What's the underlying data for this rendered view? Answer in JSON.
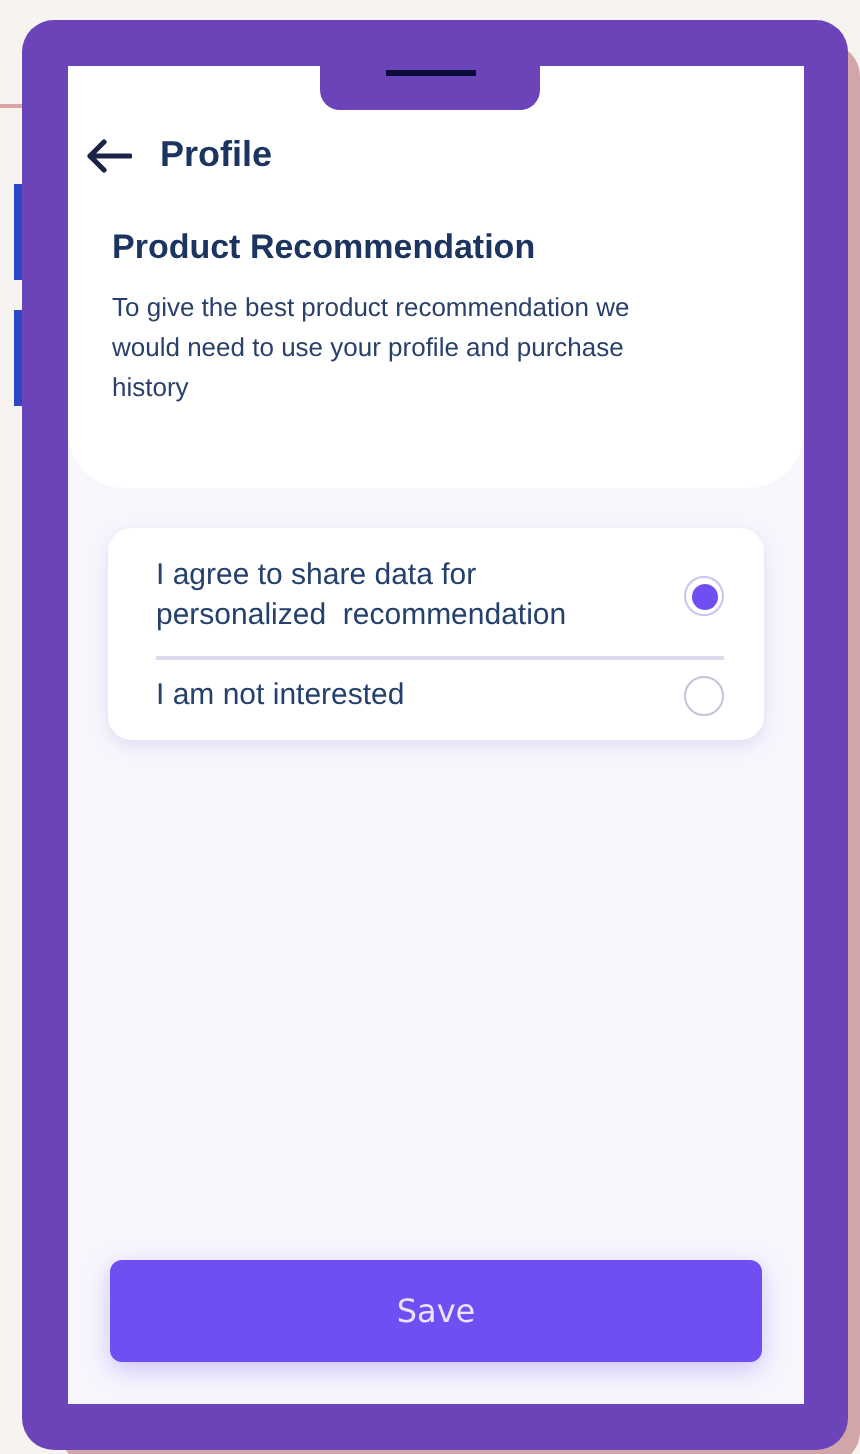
{
  "header": {
    "title": "Profile"
  },
  "section": {
    "title": "Product Recommendation",
    "description": "To give the best product recommendation we would need to use your profile and purchase history"
  },
  "options": [
    {
      "label": "I agree to share data for personalized  recommendation",
      "selected": true
    },
    {
      "label": "I am not interested",
      "selected": false
    }
  ],
  "save_button": {
    "label": "Save"
  }
}
